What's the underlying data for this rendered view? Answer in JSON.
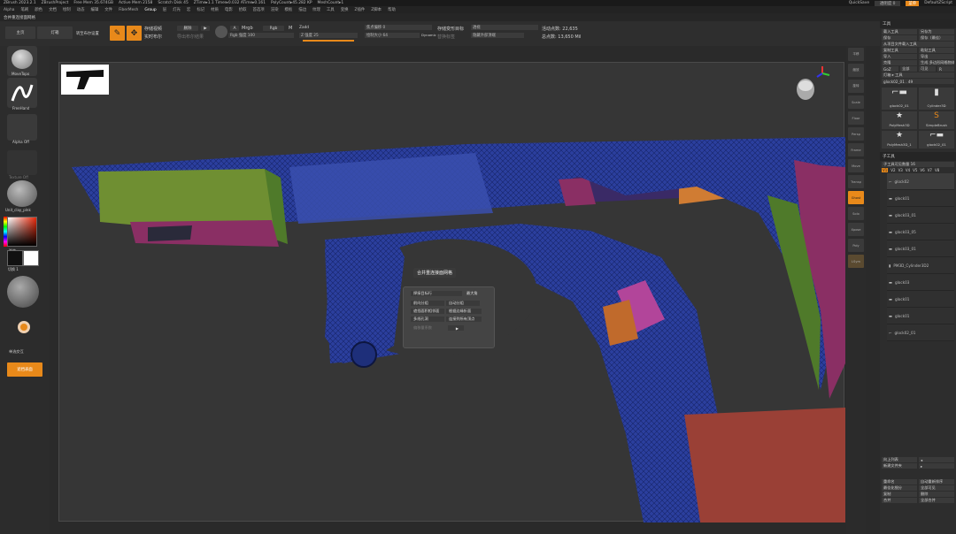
{
  "titlebar": {
    "items": [
      "ZBrush 2023.2.1",
      "ZBrushProject",
      "Free Mem 35.674GB",
      "Active Mem 2158",
      "Scratch Disk 45",
      "ZTime▸1.1 Timer▸0.032 ATime▸0.161",
      "PolyCount▸45.282 KP",
      "MeshCount▸1"
    ],
    "quicksave": "QuickSave",
    "transparency": "透明度 0",
    "menu_label": "菜单",
    "default_script": "DefaultZScript"
  },
  "menubar": {
    "items": [
      "Alpha",
      "笔刷",
      "颜色",
      "文档",
      "绘制",
      "动态",
      "编辑",
      "文件",
      "FiberMesh",
      "Group",
      "层",
      "灯光",
      "宏",
      "标记",
      "材质",
      "电影",
      "拾取",
      "首选项",
      "渲染",
      "模板",
      "描边",
      "纹理",
      "工具",
      "变换",
      "Z插件",
      "Z脚本",
      "帮助"
    ]
  },
  "subbar": {
    "label": "合并重连接面网格"
  },
  "toolbar": {
    "home": "主页",
    "lightbox": "灯箱",
    "switch": "转至布尔设置",
    "edit": "编辑",
    "draw": "绘制",
    "render_boolean": "存储视频",
    "delete": "删除",
    "live_boolean": "实时布尔",
    "export": "导出布尔结果",
    "mrgb": "Mrgb",
    "rgb": "Rgb",
    "m": "M",
    "rgb_intensity": "Rgb 强度 100",
    "zadd": "Zadd",
    "zsub": "Zsub",
    "focal_shift": "焦点偏移 0",
    "z_intensity": "Z 强度 25",
    "draw_size_label": "绘制大小 64",
    "dynamic": "Dynamic",
    "active_points": "活动点数: 22,635",
    "total_points": "总点数: 13,650 Mil",
    "perspective": "透视",
    "floor": "地面",
    "store_all": "存储变形目标",
    "replay": "替换标签",
    "spotlight": "隐藏外部顶端"
  },
  "leftshelf": {
    "brush_name": "MoveTopo",
    "stroke_name": "FreeHand",
    "alpha_name": "Alpha Off",
    "texture_name": "Texture Off",
    "material_name": "Unit_clay_plnk",
    "gradient_label": "渐变",
    "switch_color": "切换 1",
    "dynamic_label": "单选交互",
    "active_btn": "遮挡表面"
  },
  "dialog": {
    "title": "合并重连接面网格",
    "dropdown": "焊接目标行",
    "max_label": "最大角",
    "rows": [
      [
        "前向分组",
        "自动分组"
      ],
      [
        "遮挡面积相邻面",
        "根据边缘折面"
      ],
      [
        "多线孔洞",
        "连接到所有顶点"
      ]
    ],
    "bottom": "偏移量系数"
  },
  "vtools": {
    "items": [
      "平移",
      "缩放",
      "旋转",
      "Scale",
      "Floor",
      "Persp",
      "Frame",
      "Move",
      "Transp",
      "Ghost",
      "Solo",
      "Xpose",
      "Poly",
      "LSym"
    ]
  },
  "rightpanel": {
    "header": "工具",
    "buttons": [
      [
        "载入工具",
        "另存为"
      ],
      [
        "保存",
        "保存（最佳）"
      ],
      [
        "从项目文件载入工具"
      ],
      [
        "复制工具",
        "粘贴工具"
      ],
      [
        "导入",
        "导出"
      ],
      [
        "克隆",
        "生成 多边形网格物体"
      ],
      [
        "GoZ",
        "全部",
        "可见",
        "R"
      ],
      [
        "灯箱 ▸ 工具"
      ]
    ],
    "current_tool": "glock02_01 . 49",
    "thumbs": [
      "glock02_01",
      "Cylinder3D",
      "PolyMesh3D",
      "SimpleBrush",
      "PolyMesh3D_1",
      "glock02_01"
    ],
    "subtool_header": "子工具",
    "subtool_count": "子工具可见数量 16",
    "visibility": [
      "V1",
      "V2",
      "V3",
      "V4",
      "V5",
      "V6",
      "V7",
      "V8"
    ],
    "subtools": [
      "glock02",
      "glock01",
      "glock03_01",
      "glock03_05",
      "glock03_01",
      "PM3D_Cylinder3D2",
      "glock03",
      "glock01",
      "glock01",
      "glock02_01"
    ],
    "bottom": [
      [
        "向上列表",
        "◂"
      ],
      [
        "新建文件夹",
        "▸"
      ],
      [
        "重命名",
        "自动重新排序"
      ],
      [
        "最佳化细分",
        "全部可见"
      ],
      [
        "复制",
        "删除"
      ],
      [
        "合并",
        "全部合并"
      ]
    ]
  }
}
